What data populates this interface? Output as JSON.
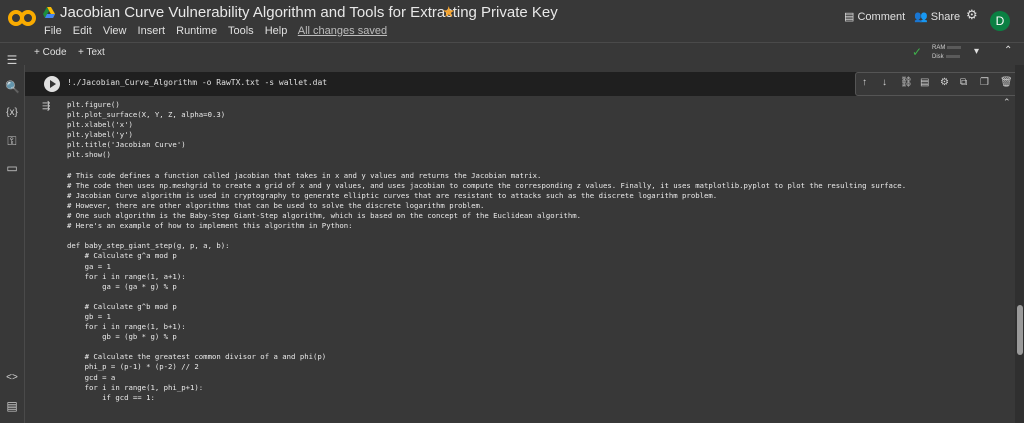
{
  "header": {
    "title": "Jacobian Curve Vulnerability Algorithm and Tools for Extracting Private Key",
    "menu": [
      "File",
      "Edit",
      "View",
      "Insert",
      "Runtime",
      "Tools",
      "Help"
    ],
    "saved_status": "All changes saved",
    "comment_label": "Comment",
    "share_label": "Share",
    "avatar_letter": "D",
    "logo_text": "CO"
  },
  "toolbar": {
    "add_code": "+ Code",
    "add_text": "+ Text",
    "ram_label": "RAM",
    "disk_label": "Disk"
  },
  "cell": {
    "command": "!./Jacobian_Curve_Algorithm -o RawTX.txt -s wallet.dat",
    "output_lines": [
      "plt.figure()",
      "plt.plot_surface(X, Y, Z, alpha=0.3)",
      "plt.xlabel('x')",
      "plt.ylabel('y')",
      "plt.title('Jacobian Curve')",
      "plt.show()",
      "",
      "# This code defines a function called jacobian that takes in x and y values and returns the Jacobian matrix.",
      "# The code then uses np.meshgrid to create a grid of x and y values, and uses jacobian to compute the corresponding z values. Finally, it uses matplotlib.pyplot to plot the resulting surface.",
      "# Jacobian Curve algorithm is used in cryptography to generate elliptic curves that are resistant to attacks such as the discrete logarithm problem.",
      "# However, there are other algorithms that can be used to solve the discrete logarithm problem.",
      "# One such algorithm is the Baby-Step Giant-Step algorithm, which is based on the concept of the Euclidean algorithm.",
      "# Here's an example of how to implement this algorithm in Python:",
      "",
      "def baby_step_giant_step(g, p, a, b):",
      "    # Calculate g^a mod p",
      "    ga = 1",
      "    for i in range(1, a+1):",
      "        ga = (ga * g) % p",
      "",
      "    # Calculate g^b mod p",
      "    gb = 1",
      "    for i in range(1, b+1):",
      "        gb = (gb * g) % p",
      "",
      "    # Calculate the greatest common divisor of a and phi(p)",
      "    phi_p = (p-1) * (p-2) // 2",
      "    gcd = a",
      "    for i in range(1, phi_p+1):",
      "        if gcd == 1:"
    ]
  },
  "colors": {
    "background": "#383838",
    "accent_star": "#f4a32e",
    "avatar": "#0b8043",
    "check": "#3fb04b"
  }
}
